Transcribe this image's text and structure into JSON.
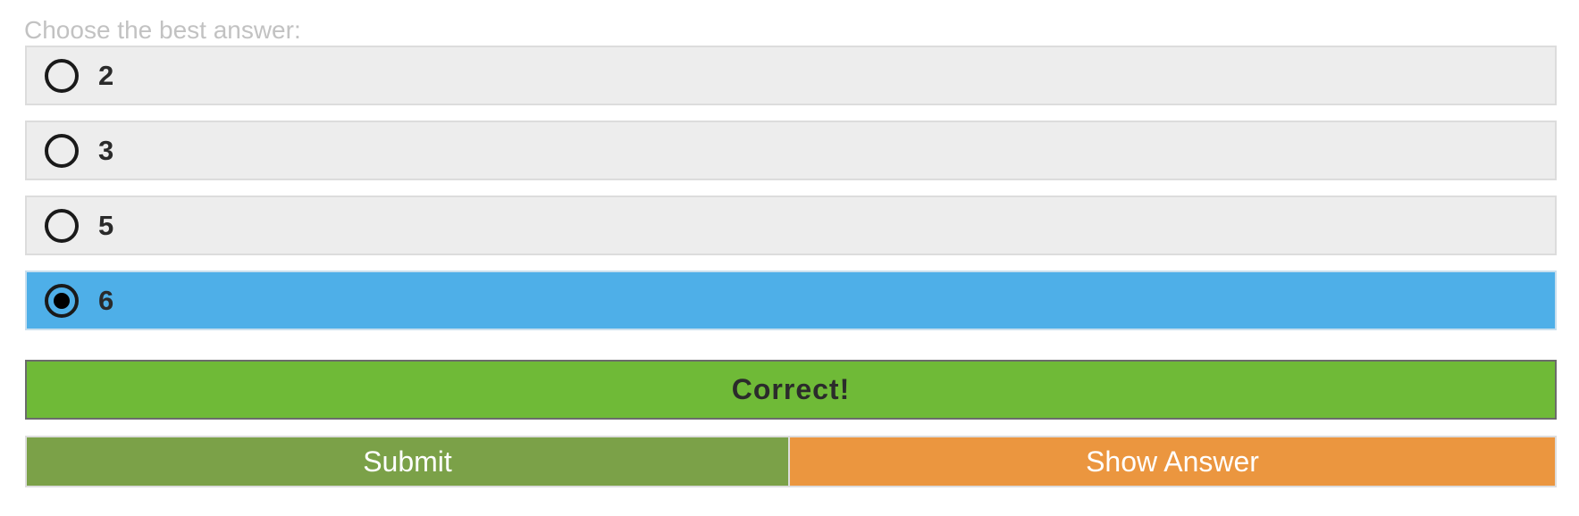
{
  "prompt": "Choose the best answer:",
  "options": [
    {
      "label": "2",
      "selected": false
    },
    {
      "label": "3",
      "selected": false
    },
    {
      "label": "5",
      "selected": false
    },
    {
      "label": "6",
      "selected": true
    }
  ],
  "feedback": "Correct!",
  "buttons": {
    "submit_label": "Submit",
    "show_answer_label": "Show Answer"
  },
  "colors": {
    "option_background": "#ededed",
    "selected_background": "#4eafe8",
    "feedback_background": "#6fba37",
    "submit_background": "#7ba148",
    "show_answer_background": "#eb963f"
  }
}
